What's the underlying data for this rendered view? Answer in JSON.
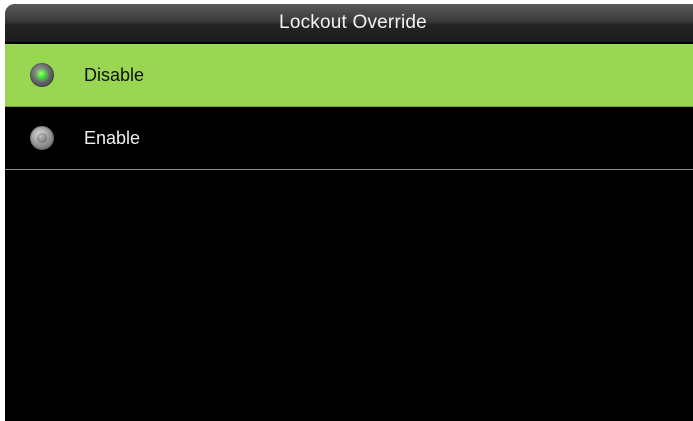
{
  "header": {
    "title": "Lockout Override"
  },
  "options": [
    {
      "label": "Disable",
      "selected": true,
      "icon": "radio-checked-icon"
    },
    {
      "label": "Enable",
      "selected": false,
      "icon": "radio-unchecked-icon"
    }
  ],
  "colors": {
    "selected_row": "#99d651",
    "background": "#000000",
    "radio_active": "#3fd43a",
    "title_bar": "#2a2a2a"
  }
}
